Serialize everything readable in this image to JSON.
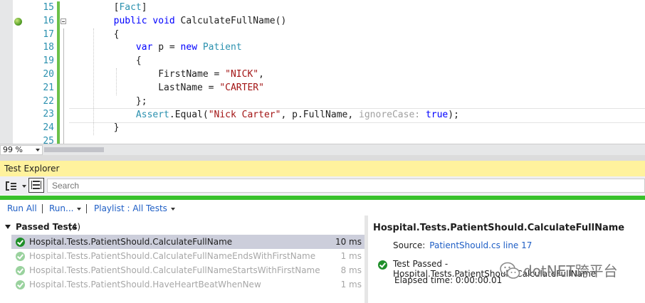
{
  "editor": {
    "zoom": "99 %",
    "lines": [
      {
        "num": "15",
        "tokens": [
          {
            "t": "        [",
            "c": ""
          },
          {
            "t": "Fact",
            "c": "ty"
          },
          {
            "t": "]",
            "c": ""
          }
        ]
      },
      {
        "num": "16",
        "tokens": [
          {
            "t": "        ",
            "c": ""
          },
          {
            "t": "public",
            "c": "kw"
          },
          {
            "t": " ",
            "c": ""
          },
          {
            "t": "void",
            "c": "kw"
          },
          {
            "t": " CalculateFullName()",
            "c": ""
          }
        ],
        "breakpoint": true,
        "fold": true
      },
      {
        "num": "17",
        "tokens": [
          {
            "t": "        {",
            "c": ""
          }
        ]
      },
      {
        "num": "18",
        "tokens": [
          {
            "t": "            ",
            "c": ""
          },
          {
            "t": "var",
            "c": "kw"
          },
          {
            "t": " p = ",
            "c": ""
          },
          {
            "t": "new",
            "c": "kw"
          },
          {
            "t": " ",
            "c": ""
          },
          {
            "t": "Patient",
            "c": "ty"
          }
        ]
      },
      {
        "num": "19",
        "tokens": [
          {
            "t": "            {",
            "c": ""
          }
        ]
      },
      {
        "num": "20",
        "tokens": [
          {
            "t": "                FirstName = ",
            "c": ""
          },
          {
            "t": "\"NICK\"",
            "c": "st"
          },
          {
            "t": ",",
            "c": ""
          }
        ]
      },
      {
        "num": "21",
        "tokens": [
          {
            "t": "                LastName = ",
            "c": ""
          },
          {
            "t": "\"CARTER\"",
            "c": "st"
          }
        ]
      },
      {
        "num": "22",
        "tokens": [
          {
            "t": "            };",
            "c": ""
          }
        ]
      },
      {
        "num": "23",
        "tokens": [
          {
            "t": "            ",
            "c": ""
          },
          {
            "t": "Assert",
            "c": "ty"
          },
          {
            "t": ".Equal(",
            "c": ""
          },
          {
            "t": "\"Nick Carter\"",
            "c": "st"
          },
          {
            "t": ", p.FullName, ",
            "c": ""
          },
          {
            "t": "ignoreCase:",
            "c": "hint"
          },
          {
            "t": " ",
            "c": ""
          },
          {
            "t": "true",
            "c": "kw"
          },
          {
            "t": ");",
            "c": ""
          }
        ],
        "current": true
      },
      {
        "num": "24",
        "tokens": [
          {
            "t": "        }",
            "c": ""
          }
        ]
      },
      {
        "num": "25",
        "tokens": []
      }
    ]
  },
  "test_explorer": {
    "title": "Test Explorer",
    "search_placeholder": "Search",
    "run_all": "Run All",
    "run": "Run...",
    "playlist": "Playlist : All Tests",
    "group": {
      "name": "Passed Tests",
      "count": "(4)"
    },
    "tests": [
      {
        "name": "Hospital.Tests.PatientShould.CalculateFullName",
        "time": "10 ms",
        "selected": true
      },
      {
        "name": "Hospital.Tests.PatientShould.CalculateFullNameEndsWithFirstName",
        "time": "1 ms",
        "selected": false
      },
      {
        "name": "Hospital.Tests.PatientShould.CalculateFullNameStartsWithFirstName",
        "time": "8 ms",
        "selected": false
      },
      {
        "name": "Hospital.Tests.PatientShould.HaveHeartBeatWhenNew",
        "time": "1 ms",
        "selected": false
      }
    ],
    "detail": {
      "title": "Hospital.Tests.PatientShould.CalculateFullName",
      "source_label": "Source:",
      "source_link": "PatientShould.cs line 17",
      "status": "Test Passed - Hospital.Tests.PatientShould.CalculateFullName",
      "elapsed": "Elapsed time: 0:00:00.01"
    },
    "watermark": "dotNET跨平台"
  },
  "colors": {
    "accent_green": "#39c12c",
    "title_yellow": "#fff29d",
    "link_blue": "#1e5ec5"
  }
}
